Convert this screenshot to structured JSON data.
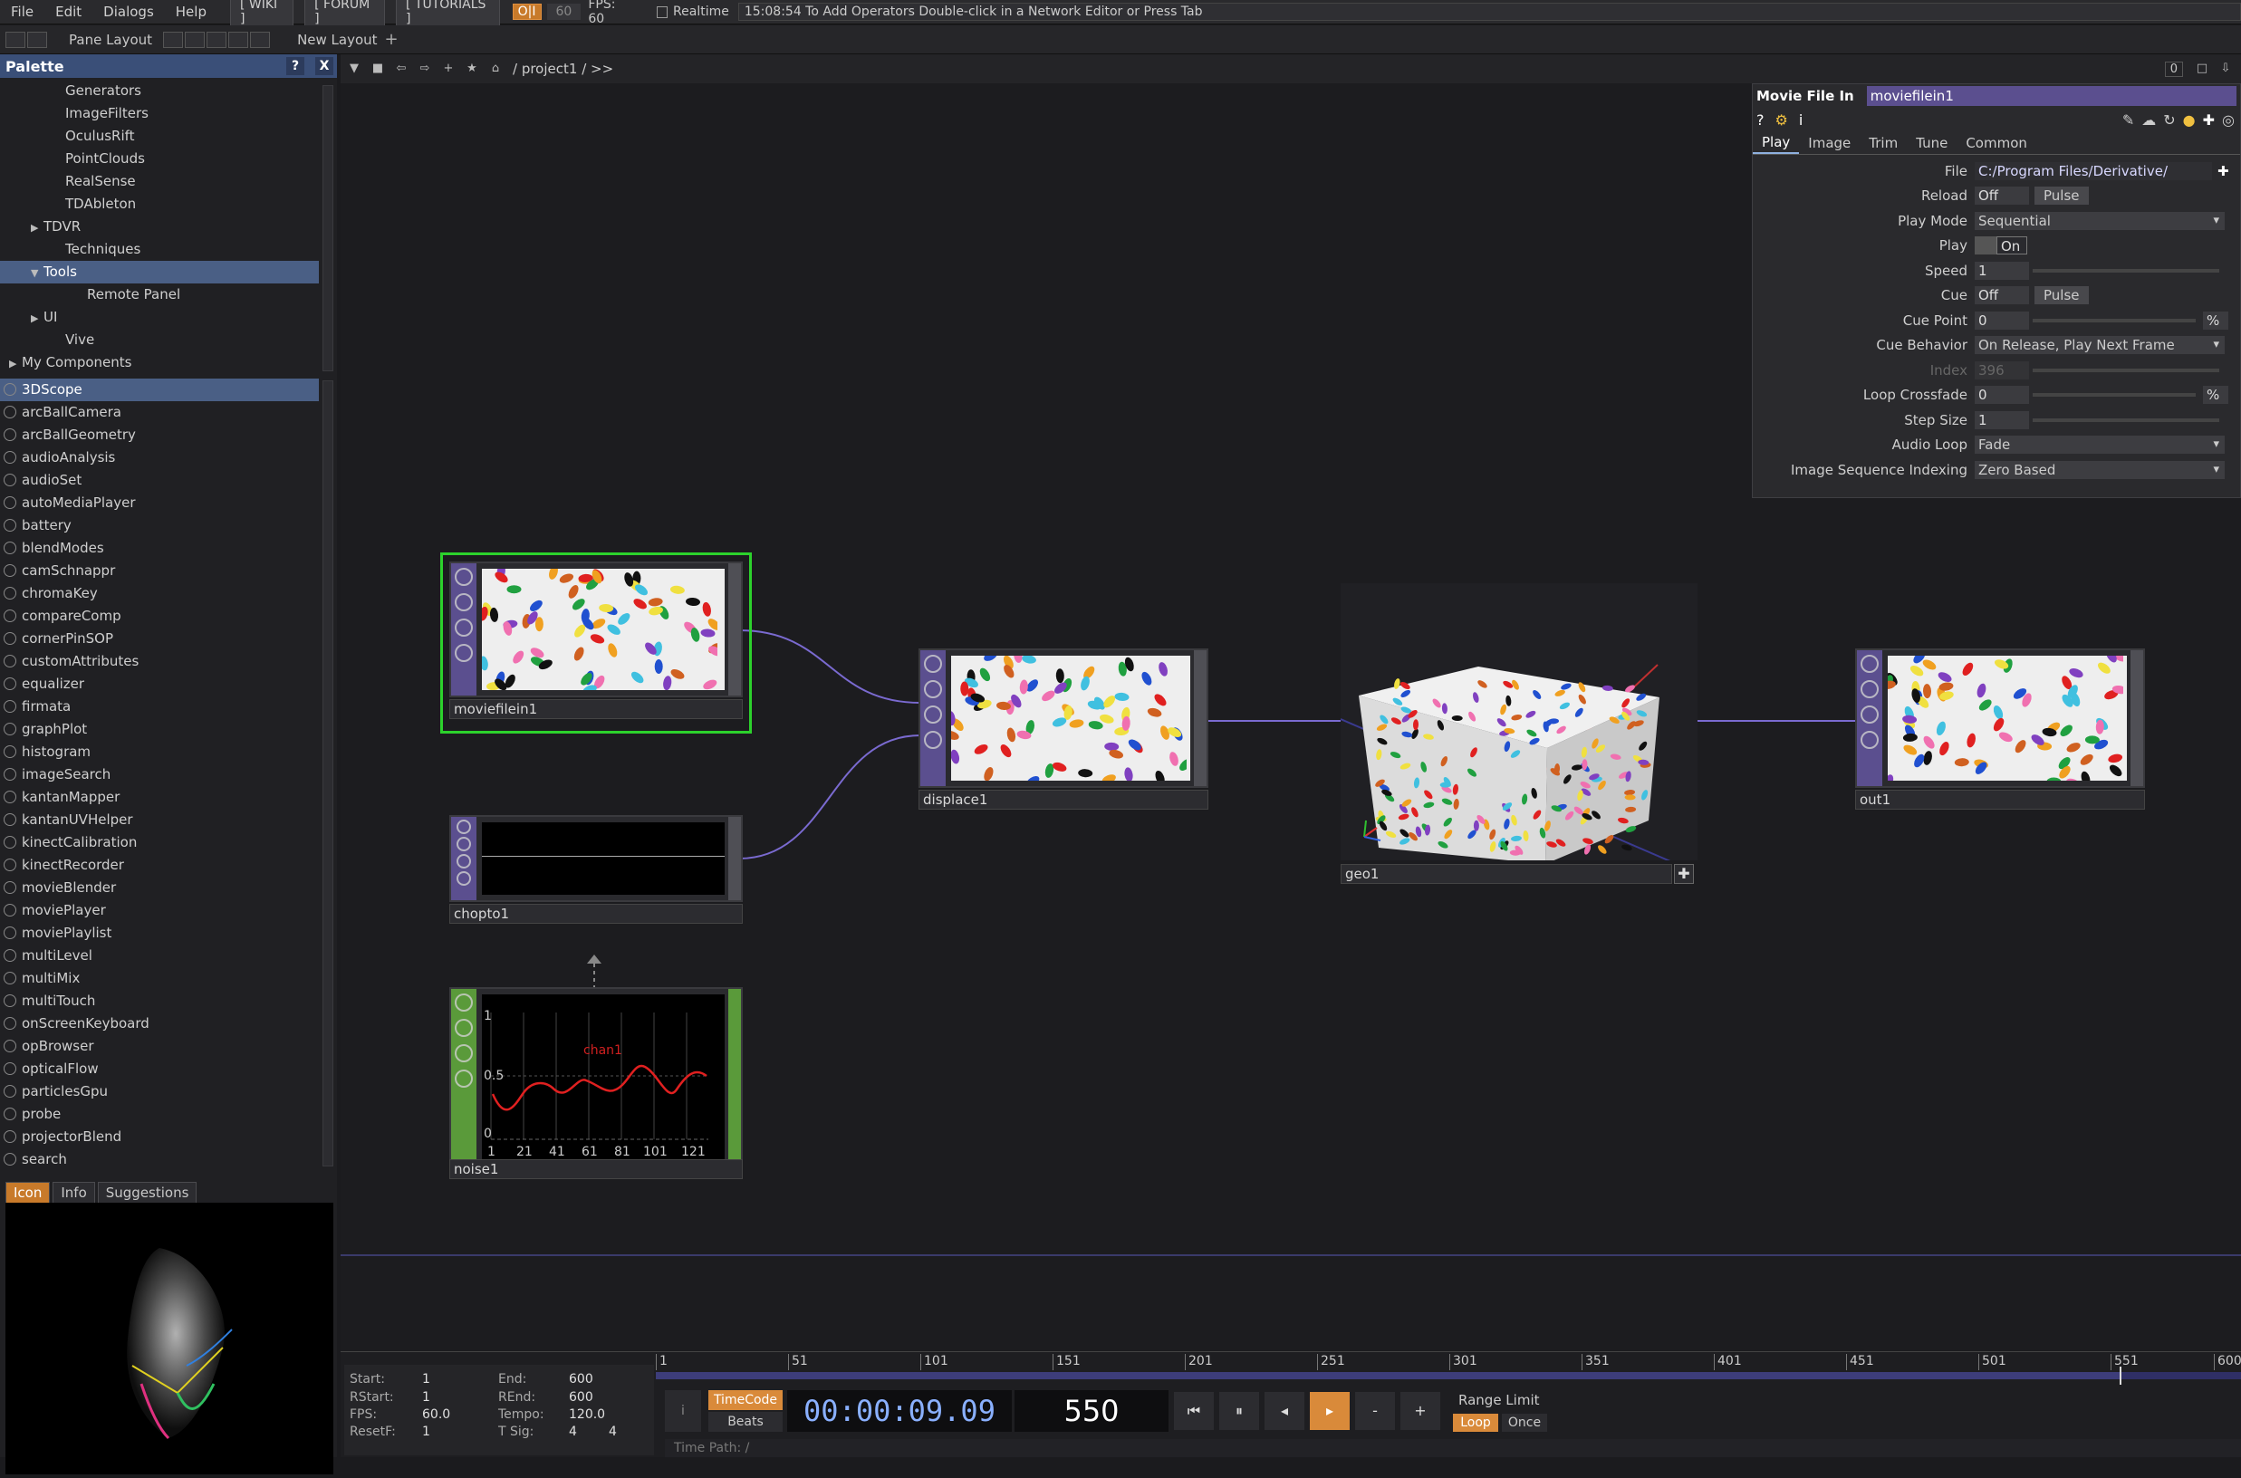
{
  "menubar": {
    "items": [
      "File",
      "Edit",
      "Dialogs",
      "Help"
    ],
    "wiki": "[ WIKI ]",
    "forum": "[ FORUM ]",
    "tutorials": "[ TUTORIALS ]",
    "oi": "O|I",
    "fps_target": "60",
    "fps_label": "FPS: 60",
    "realtime": "Realtime",
    "status": "15:08:54 To Add Operators Double-click in a Network Editor or Press Tab"
  },
  "toolbar2": {
    "pane_layout": "Pane Layout",
    "new_layout": "New Layout"
  },
  "palette": {
    "title": "Palette",
    "help": "?",
    "close": "X",
    "tree": [
      {
        "label": "Generators",
        "indent": 2
      },
      {
        "label": "ImageFilters",
        "indent": 2
      },
      {
        "label": "OculusRift",
        "indent": 2
      },
      {
        "label": "PointClouds",
        "indent": 2
      },
      {
        "label": "RealSense",
        "indent": 2
      },
      {
        "label": "TDAbleton",
        "indent": 2
      },
      {
        "label": "TDVR",
        "indent": 1,
        "arrow": "▶"
      },
      {
        "label": "Techniques",
        "indent": 2
      },
      {
        "label": "Tools",
        "indent": 1,
        "arrow": "▼",
        "selected": true
      },
      {
        "label": "Remote Panel",
        "indent": 3
      },
      {
        "label": "UI",
        "indent": 1,
        "arrow": "▶"
      },
      {
        "label": "Vive",
        "indent": 2
      },
      {
        "label": "My Components",
        "indent": 0,
        "arrow": "▶"
      }
    ],
    "components": [
      "3DScope",
      "arcBallCamera",
      "arcBallGeometry",
      "audioAnalysis",
      "audioSet",
      "autoMediaPlayer",
      "battery",
      "blendModes",
      "camSchnappr",
      "chromaKey",
      "compareComp",
      "cornerPinSOP",
      "customAttributes",
      "equalizer",
      "firmata",
      "graphPlot",
      "histogram",
      "imageSearch",
      "kantanMapper",
      "kantanUVHelper",
      "kinectCalibration",
      "kinectRecorder",
      "movieBlender",
      "moviePlayer",
      "moviePlaylist",
      "multiLevel",
      "multiMix",
      "multiTouch",
      "onScreenKeyboard",
      "opBrowser",
      "opticalFlow",
      "particlesGpu",
      "probe",
      "projectorBlend",
      "search"
    ],
    "tabs": [
      "Icon",
      "Info",
      "Suggestions"
    ]
  },
  "network": {
    "path": "/ project1 / >>",
    "right_btn": "0",
    "nodes": {
      "moviefilein1": "moviefilein1",
      "chopto1": "chopto1",
      "noise1": "noise1",
      "displace1": "displace1",
      "geo1": "geo1",
      "out1": "out1"
    },
    "noise_chart": {
      "channel": "chan1",
      "y_ticks": [
        "1",
        "0.5",
        "0"
      ],
      "x_ticks": [
        "1",
        "21",
        "41",
        "61",
        "81",
        "101",
        "121"
      ]
    }
  },
  "params": {
    "op_type": "Movie File In",
    "op_name": "moviefilein1",
    "tabs": [
      "Play",
      "Image",
      "Trim",
      "Tune",
      "Common"
    ],
    "rows": [
      {
        "label": "File",
        "kind": "text",
        "value": "C:/Program Files/Derivative/"
      },
      {
        "label": "Reload",
        "kind": "toggle",
        "value": "Off",
        "btn": "Pulse"
      },
      {
        "label": "Play Mode",
        "kind": "menu",
        "value": "Sequential"
      },
      {
        "label": "Play",
        "kind": "onoff",
        "value": "On"
      },
      {
        "label": "Speed",
        "kind": "slider",
        "value": "1"
      },
      {
        "label": "Cue",
        "kind": "toggle",
        "value": "Off",
        "btn": "Pulse"
      },
      {
        "label": "Cue Point",
        "kind": "slider",
        "value": "0",
        "unit": "%"
      },
      {
        "label": "Cue Behavior",
        "kind": "menu",
        "value": "On Release, Play Next Frame"
      },
      {
        "label": "Index",
        "kind": "slider",
        "value": "396",
        "dim": true
      },
      {
        "label": "Loop Crossfade",
        "kind": "slider",
        "value": "0",
        "unit": "%"
      },
      {
        "label": "Step Size",
        "kind": "slider",
        "value": "1"
      },
      {
        "label": "Audio Loop",
        "kind": "menu",
        "value": "Fade"
      },
      {
        "label": "Image Sequence Indexing",
        "kind": "menu",
        "value": "Zero Based"
      }
    ]
  },
  "timeline": {
    "info": {
      "start_l": "Start:",
      "start_v": "1",
      "end_l": "End:",
      "end_v": "600",
      "rstart_l": "RStart:",
      "rstart_v": "1",
      "rend_l": "REnd:",
      "rend_v": "600",
      "fps_l": "FPS:",
      "fps_v": "60.0",
      "tempo_l": "Tempo:",
      "tempo_v": "120.0",
      "resetf_l": "ResetF:",
      "resetf_v": "1",
      "tsig_l": "T Sig:",
      "tsig_v1": "4",
      "tsig_v2": "4"
    },
    "ruler": [
      "1",
      "51",
      "101",
      "151",
      "201",
      "251",
      "301",
      "351",
      "401",
      "451",
      "501",
      "551",
      "600"
    ],
    "timecode_label": "TimeCode",
    "beats_label": "Beats",
    "timecode": "00:00:09.09",
    "frame": "550",
    "range_limit": "Range Limit",
    "loop": "Loop",
    "once": "Once",
    "time_path": "Time Path: /"
  }
}
